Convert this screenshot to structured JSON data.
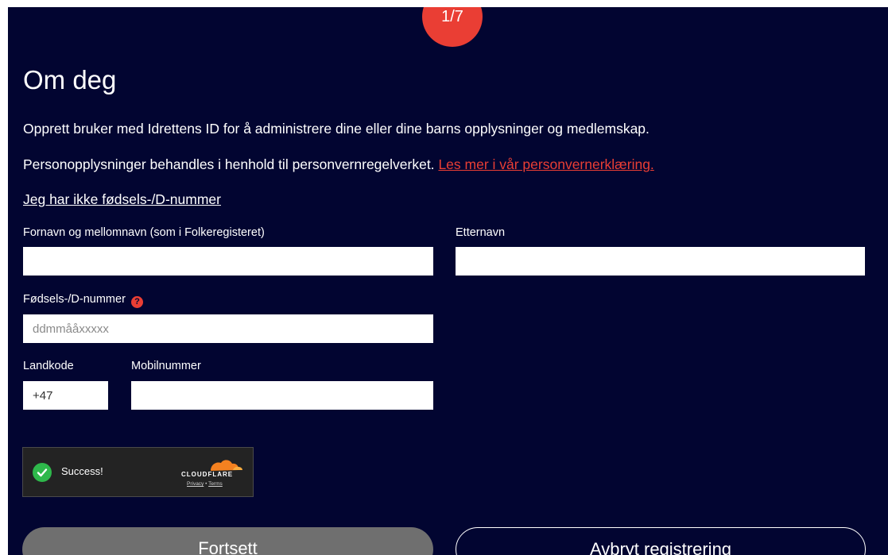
{
  "step_badge": "1/7",
  "title": "Om deg",
  "intro": "Opprett bruker med Idrettens ID for å administrere dine eller dine barns opplysninger og medlemskap.",
  "privacy": {
    "text": "Personopplysninger behandles i henhold til personvernregelverket.",
    "link": "Les mer i vår personvernerklæring."
  },
  "no_id_link": "Jeg har ikke fødsels-/D-nummer",
  "form": {
    "firstname_label": "Fornavn og mellomnavn (som i Folkeregisteret)",
    "firstname_value": "",
    "lastname_label": "Etternavn",
    "lastname_value": "",
    "birthnumber_label": "Fødsels-/D-nummer",
    "birthnumber_placeholder": "ddmmååxxxxx",
    "birthnumber_help_icon": "question-circle-icon",
    "countrycode_label": "Landkode",
    "countrycode_value": "+47",
    "mobile_label": "Mobilnummer",
    "mobile_value": ""
  },
  "captcha": {
    "status": "Success!",
    "brand": "CLOUDFLARE",
    "privacy": "Privacy",
    "separator": "•",
    "terms": "Terms"
  },
  "buttons": {
    "continue": "Fortsett",
    "cancel": "Avbryt registrering"
  },
  "colors": {
    "background": "#020531",
    "accent": "#ea3e34",
    "disabled_button": "#6f6f6f",
    "captcha_success": "#2eb84b"
  }
}
